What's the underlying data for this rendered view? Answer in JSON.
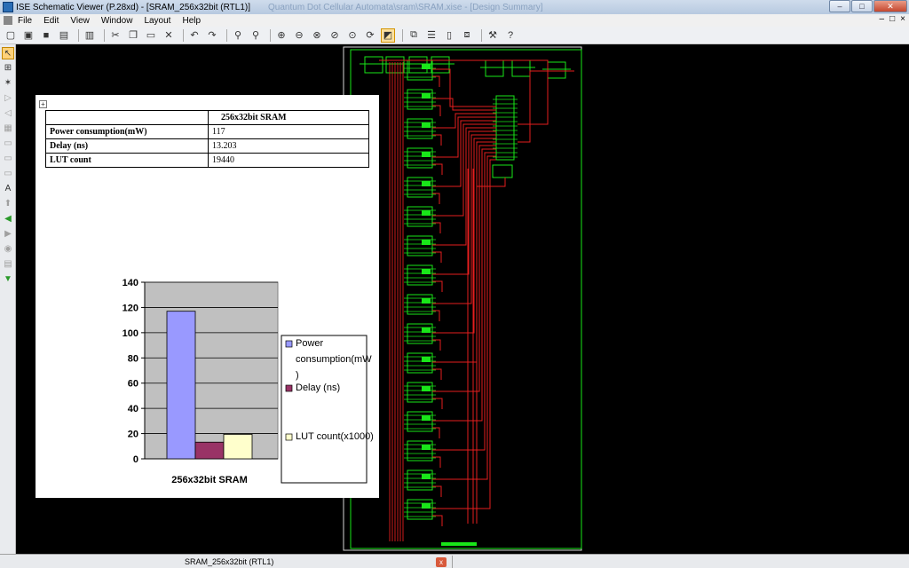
{
  "window": {
    "title": "ISE Schematic Viewer (P.28xd) - [SRAM_256x32bit (RTL1)]",
    "title_ghost": "Quantum Dot Cellular Automata\\sram\\SRAM.xise - [Design Summary]",
    "minimize": "–",
    "maximize": "□",
    "close": "✕"
  },
  "menu": {
    "items": [
      "File",
      "Edit",
      "View",
      "Window",
      "Layout",
      "Help"
    ],
    "right_min": "–",
    "right_max": "□",
    "right_close": "×"
  },
  "status": {
    "tab_label": "SRAM_256x32bit (RTL1)",
    "tab_close": "x"
  },
  "doc": {
    "move_handle": "+",
    "table": {
      "header": "256x32bit SRAM",
      "rows": [
        {
          "label": "Power consumption(mW)",
          "value": "117"
        },
        {
          "label": "Delay (ns)",
          "value": "13.203"
        },
        {
          "label": "LUT count",
          "value": "19440"
        }
      ]
    }
  },
  "chart_data": {
    "type": "bar",
    "categories": [
      "256x32bit SRAM"
    ],
    "series": [
      {
        "name": "Power consumption(mW)",
        "values": [
          117
        ],
        "color": "#9999ff"
      },
      {
        "name": "Delay (ns)",
        "values": [
          13.203
        ],
        "color": "#993366"
      },
      {
        "name": "LUT count(x1000)",
        "values": [
          19.44
        ],
        "color": "#ffffcc"
      }
    ],
    "legend_lines": [
      [
        "Power",
        "consumption(mW",
        ")"
      ],
      [
        "Delay (ns)"
      ],
      [
        "LUT count(x1000)"
      ]
    ],
    "y_ticks": [
      "0",
      "20",
      "40",
      "60",
      "80",
      "100",
      "120",
      "140"
    ],
    "ylim": [
      0,
      140
    ],
    "grid": true,
    "legend_position": "right",
    "plot_background": "#c0c0c0"
  }
}
